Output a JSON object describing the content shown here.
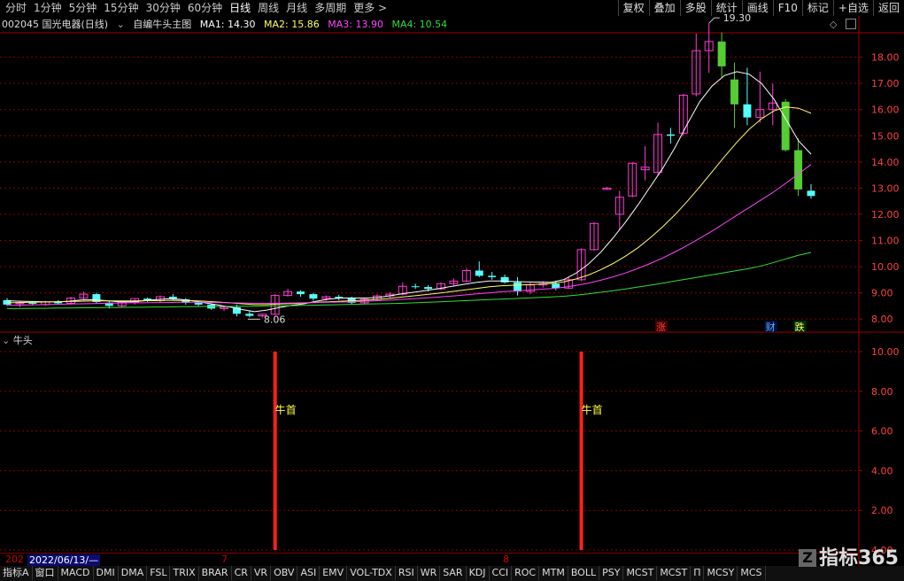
{
  "toolbar": {
    "periods": [
      "分时",
      "1分钟",
      "5分钟",
      "15分钟",
      "30分钟",
      "60分钟",
      "日线",
      "周线",
      "月线",
      "多周期",
      "更多 >"
    ],
    "active_period": "日线",
    "right_buttons": [
      "复权",
      "叠加",
      "多股",
      "统计",
      "画线",
      "F10",
      "标记",
      "+自选",
      "返回"
    ]
  },
  "info": {
    "stock": "002045 国光电器(日线)",
    "study": "自编牛头主图",
    "ma1": "MA1: 14.30",
    "ma2": "MA2: 15.86",
    "ma3": "MA3: 13.90",
    "ma4": "MA4: 10.54"
  },
  "colors": {
    "up": "#ff3ad6",
    "down": "#54ffff",
    "down_big": "#55cc33",
    "ma1": "#ffffff",
    "ma2": "#ffff66",
    "ma3": "#ff44ff",
    "ma4": "#33dd33",
    "grid": "#8a0000",
    "axis_text": "#ff4040",
    "signal": "#ff2020",
    "signal_label": "#ffff44"
  },
  "chart_data": {
    "type": "candlestick",
    "price_axis": {
      "ticks": [
        "18.00",
        "17.00",
        "16.00",
        "15.00",
        "14.00",
        "13.00",
        "12.00",
        "11.00",
        "10.00",
        "9.00",
        "8.00"
      ],
      "range": [
        7.6,
        18.9
      ]
    },
    "high_label": "19.30",
    "low_label": "8.06",
    "markers": [
      "涨",
      "财",
      "跌"
    ],
    "candles": [
      [
        8.72,
        8.8,
        8.5,
        8.55
      ],
      [
        8.6,
        8.7,
        8.45,
        8.62
      ],
      [
        8.62,
        8.66,
        8.52,
        8.58
      ],
      [
        8.55,
        8.7,
        8.5,
        8.65
      ],
      [
        8.65,
        8.72,
        8.55,
        8.6
      ],
      [
        8.6,
        8.85,
        8.55,
        8.8
      ],
      [
        8.8,
        9.05,
        8.75,
        8.95
      ],
      [
        8.95,
        9.0,
        8.6,
        8.65
      ],
      [
        8.62,
        8.68,
        8.4,
        8.5
      ],
      [
        8.5,
        8.7,
        8.45,
        8.65
      ],
      [
        8.65,
        8.8,
        8.55,
        8.78
      ],
      [
        8.78,
        8.82,
        8.65,
        8.7
      ],
      [
        8.7,
        8.9,
        8.62,
        8.85
      ],
      [
        8.85,
        8.95,
        8.7,
        8.75
      ],
      [
        8.75,
        8.8,
        8.55,
        8.62
      ],
      [
        8.62,
        8.7,
        8.5,
        8.55
      ],
      [
        8.55,
        8.6,
        8.35,
        8.4
      ],
      [
        8.4,
        8.5,
        8.3,
        8.45
      ],
      [
        8.45,
        8.55,
        8.1,
        8.2
      ],
      [
        8.2,
        8.3,
        8.06,
        8.12
      ],
      [
        8.12,
        8.2,
        8.06,
        8.18
      ],
      [
        8.18,
        8.95,
        8.15,
        8.9
      ],
      [
        8.9,
        9.15,
        8.85,
        9.05
      ],
      [
        9.05,
        9.1,
        8.85,
        8.95
      ],
      [
        8.95,
        9.0,
        8.7,
        8.78
      ],
      [
        8.78,
        8.9,
        8.7,
        8.85
      ],
      [
        8.85,
        8.92,
        8.72,
        8.8
      ],
      [
        8.8,
        8.85,
        8.55,
        8.62
      ],
      [
        8.62,
        8.8,
        8.58,
        8.75
      ],
      [
        8.75,
        8.95,
        8.7,
        8.88
      ],
      [
        8.88,
        9.02,
        8.8,
        8.95
      ],
      [
        8.95,
        9.4,
        8.9,
        9.25
      ],
      [
        9.25,
        9.35,
        9.15,
        9.22
      ],
      [
        9.22,
        9.3,
        9.05,
        9.15
      ],
      [
        9.15,
        9.4,
        9.1,
        9.35
      ],
      [
        9.35,
        9.55,
        9.25,
        9.45
      ],
      [
        9.45,
        9.95,
        9.4,
        9.85
      ],
      [
        9.85,
        10.2,
        9.6,
        9.65
      ],
      [
        9.65,
        9.8,
        9.5,
        9.6
      ],
      [
        9.6,
        9.7,
        9.35,
        9.4
      ],
      [
        9.4,
        9.6,
        8.9,
        9.05
      ],
      [
        9.05,
        9.4,
        8.95,
        9.3
      ],
      [
        9.3,
        9.45,
        9.2,
        9.35
      ],
      [
        9.35,
        9.45,
        9.1,
        9.18
      ],
      [
        9.18,
        9.6,
        9.15,
        9.5
      ],
      [
        9.5,
        10.7,
        9.45,
        10.65
      ],
      [
        10.65,
        11.7,
        10.6,
        11.65
      ],
      [
        12.95,
        13.05,
        12.95,
        13.0
      ],
      [
        12.0,
        12.9,
        11.4,
        12.65
      ],
      [
        12.7,
        14.0,
        12.65,
        13.95
      ],
      [
        13.7,
        14.6,
        13.3,
        13.8
      ],
      [
        13.6,
        15.5,
        13.5,
        15.05
      ],
      [
        15.05,
        15.3,
        14.7,
        15.0
      ],
      [
        15.1,
        16.6,
        15.0,
        16.55
      ],
      [
        16.6,
        18.9,
        16.5,
        18.25
      ],
      [
        18.25,
        19.3,
        17.4,
        18.6
      ],
      [
        18.6,
        18.95,
        17.2,
        17.65
      ],
      [
        17.15,
        17.8,
        15.3,
        16.2
      ],
      [
        16.2,
        17.6,
        15.4,
        15.7
      ],
      [
        15.7,
        17.45,
        15.5,
        16.0
      ],
      [
        16.0,
        17.0,
        15.4,
        16.25
      ],
      [
        16.3,
        16.4,
        14.4,
        14.45
      ],
      [
        14.45,
        14.9,
        12.7,
        12.95
      ],
      [
        12.9,
        13.15,
        12.6,
        12.7
      ]
    ],
    "ma1": [
      8.7,
      8.68,
      8.67,
      8.66,
      8.66,
      8.68,
      8.73,
      8.74,
      8.7,
      8.66,
      8.66,
      8.69,
      8.74,
      8.77,
      8.75,
      8.69,
      8.62,
      8.54,
      8.46,
      8.36,
      8.28,
      8.34,
      8.44,
      8.52,
      8.58,
      8.68,
      8.76,
      8.8,
      8.8,
      8.8,
      8.82,
      8.89,
      8.97,
      9.03,
      9.1,
      9.17,
      9.25,
      9.33,
      9.4,
      9.45,
      9.45,
      9.43,
      9.42,
      9.41,
      9.4,
      9.5,
      9.75,
      10.1,
      10.55,
      11.1,
      11.7,
      12.35,
      13.05,
      13.75,
      14.55,
      15.45,
      16.3,
      16.9,
      17.3,
      17.45,
      17.35,
      17.0,
      16.4,
      15.6,
      14.8,
      14.3
    ],
    "ma2": [
      8.62,
      8.63,
      8.64,
      8.65,
      8.66,
      8.67,
      8.68,
      8.69,
      8.69,
      8.69,
      8.69,
      8.7,
      8.7,
      8.71,
      8.71,
      8.7,
      8.68,
      8.65,
      8.62,
      8.58,
      8.55,
      8.55,
      8.57,
      8.59,
      8.61,
      8.64,
      8.66,
      8.68,
      8.7,
      8.72,
      8.75,
      8.79,
      8.84,
      8.89,
      8.94,
      8.99,
      9.05,
      9.11,
      9.17,
      9.23,
      9.27,
      9.29,
      9.31,
      9.33,
      9.36,
      9.42,
      9.53,
      9.68,
      9.88,
      10.12,
      10.4,
      10.72,
      11.1,
      11.52,
      11.98,
      12.5,
      13.05,
      13.62,
      14.2,
      14.75,
      15.25,
      15.65,
      15.95,
      16.1,
      16.05,
      15.86
    ],
    "ma3": [
      8.52,
      8.53,
      8.54,
      8.55,
      8.56,
      8.57,
      8.58,
      8.59,
      8.6,
      8.61,
      8.62,
      8.62,
      8.63,
      8.63,
      8.64,
      8.64,
      8.64,
      8.63,
      8.62,
      8.61,
      8.6,
      8.6,
      8.6,
      8.61,
      8.62,
      8.63,
      8.64,
      8.65,
      8.66,
      8.68,
      8.7,
      8.72,
      8.75,
      8.78,
      8.81,
      8.84,
      8.88,
      8.92,
      8.96,
      9.0,
      9.04,
      9.07,
      9.1,
      9.13,
      9.16,
      9.21,
      9.28,
      9.37,
      9.48,
      9.61,
      9.76,
      9.93,
      10.12,
      10.33,
      10.56,
      10.81,
      11.08,
      11.36,
      11.66,
      11.96,
      12.26,
      12.56,
      12.86,
      13.2,
      13.55,
      13.9
    ],
    "ma4": [
      8.4,
      8.4,
      8.41,
      8.41,
      8.42,
      8.42,
      8.43,
      8.43,
      8.44,
      8.44,
      8.45,
      8.45,
      8.46,
      8.46,
      8.47,
      8.47,
      8.48,
      8.48,
      8.48,
      8.49,
      8.49,
      8.5,
      8.5,
      8.51,
      8.52,
      8.53,
      8.54,
      8.55,
      8.56,
      8.57,
      8.58,
      8.59,
      8.6,
      8.62,
      8.64,
      8.66,
      8.68,
      8.7,
      8.72,
      8.74,
      8.76,
      8.78,
      8.8,
      8.82,
      8.84,
      8.87,
      8.91,
      8.96,
      9.02,
      9.08,
      9.15,
      9.22,
      9.29,
      9.37,
      9.45,
      9.53,
      9.61,
      9.69,
      9.77,
      9.85,
      9.93,
      10.03,
      10.16,
      10.3,
      10.44,
      10.54
    ],
    "sub_panel": {
      "title": "牛头",
      "axis_ticks": [
        "10.00",
        "8.00",
        "6.00",
        "4.00",
        "2.00",
        "4.00"
      ],
      "range": [
        0,
        10
      ],
      "signals": [
        {
          "candle_index": 21,
          "value": 10,
          "label": "牛首"
        },
        {
          "candle_index": 45,
          "value": 10,
          "label": "牛首"
        }
      ]
    }
  },
  "dateaxis": {
    "year_prefix": "202",
    "cursor_date": "2022/06/13/—",
    "month_ticks": [
      "7",
      "8"
    ]
  },
  "tabs": [
    "指标A",
    "窗口",
    "MACD",
    "DMI",
    "DMA",
    "FSL",
    "TRIX",
    "BRAR",
    "CR",
    "VR",
    "OBV",
    "ASI",
    "EMV",
    "VOL-TDX",
    "RSI",
    "WR",
    "SAR",
    "KDJ",
    "CCI",
    "ROC",
    "MTM",
    "BOLL",
    "PSY",
    "MCST",
    "MCST",
    "Π",
    "MCSY",
    "MCS"
  ],
  "watermark": "指标365"
}
